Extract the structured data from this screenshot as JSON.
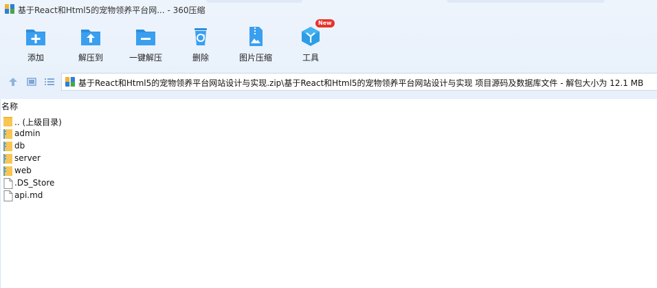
{
  "window": {
    "title": "基于React和Html5的宠物领养平台网... - 360压缩"
  },
  "toolbar": {
    "items": [
      {
        "label": "添加",
        "icon": "add-icon"
      },
      {
        "label": "解压到",
        "icon": "extract-to-icon"
      },
      {
        "label": "一键解压",
        "icon": "one-click-extract-icon"
      },
      {
        "label": "删除",
        "icon": "delete-icon"
      },
      {
        "label": "图片压缩",
        "icon": "image-compress-icon"
      },
      {
        "label": "工具",
        "icon": "tools-icon",
        "badge": "New"
      }
    ]
  },
  "navigation": {
    "path": "基于React和Html5的宠物领养平台网站设计与实现.zip\\基于React和Html5的宠物领养平台网站设计与实现 项目源码及数据库文件 - 解包大小为 12.1 MB"
  },
  "file_list": {
    "column_name": "名称",
    "rows": [
      {
        "name": ".. (上级目录)",
        "type": "parent"
      },
      {
        "name": "admin",
        "type": "folder"
      },
      {
        "name": "db",
        "type": "folder"
      },
      {
        "name": "server",
        "type": "folder"
      },
      {
        "name": "web",
        "type": "folder"
      },
      {
        "name": ".DS_Store",
        "type": "file"
      },
      {
        "name": "api.md",
        "type": "file"
      }
    ]
  },
  "colors": {
    "accent": "#2b8ee0",
    "badge": "#e8322b",
    "folder": "#f7c653"
  }
}
